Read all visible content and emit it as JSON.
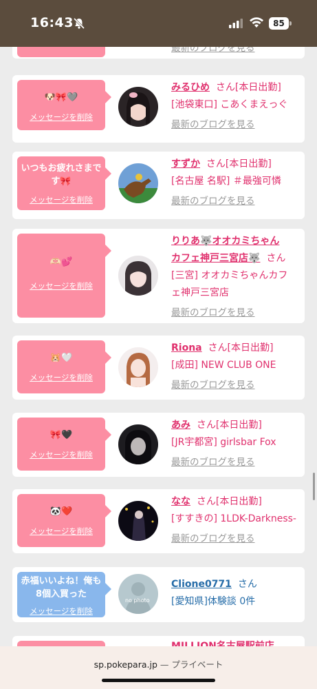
{
  "status": {
    "time": "16:43",
    "battery": "85"
  },
  "browser": {
    "url": "sp.pokepara.jp",
    "mode": "— プライベート"
  },
  "delete_label": "メッセージを削除",
  "blog_label": "最新のブログを見る",
  "san": "さん",
  "cards": [
    {
      "message": "",
      "name": "",
      "lines": [
        ""
      ],
      "blog": "最新のブログを見る"
    },
    {
      "message": "🐶🎀🩶",
      "name": "みるひめ",
      "tag": "[本日出勤]",
      "lines": [
        "[池袋東口] こあくまえっぐ"
      ]
    },
    {
      "message": "いつもお疲れさまです🎀",
      "name": "すずか",
      "tag": "[本日出勤]",
      "lines": [
        "[名古屋 名駅] ＃最強可憐"
      ]
    },
    {
      "message": "🫶🏻💕",
      "name_line1": "りりあ🐺オオカミちゃん",
      "name_line2": "カフェ神戸三宮店🐺",
      "lines": [
        "[三宮] オオカミちゃんカフ",
        "ェ神戸三宮店"
      ]
    },
    {
      "message": "🐹🤍",
      "name": "Riona",
      "tag": "[本日出勤]",
      "lines": [
        "[成田] NEW CLUB ONE"
      ]
    },
    {
      "message": "🎀🖤",
      "name": "あみ",
      "tag": "[本日出勤]",
      "lines": [
        "[JR宇都宮] girlsbar Fox"
      ]
    },
    {
      "message": "🐼❤️",
      "name": "なな",
      "tag": "[本日出勤]",
      "lines": [
        "[すすきの] 1LDK-Darkness-"
      ]
    },
    {
      "message": "赤福いいよね！俺も8個入買った",
      "name": "Clione0771",
      "lines": [
        "[愛知県]体験談 0件"
      ],
      "avatar_text": "no photo"
    },
    {
      "name": "MILLION名古屋駅前店"
    }
  ]
}
